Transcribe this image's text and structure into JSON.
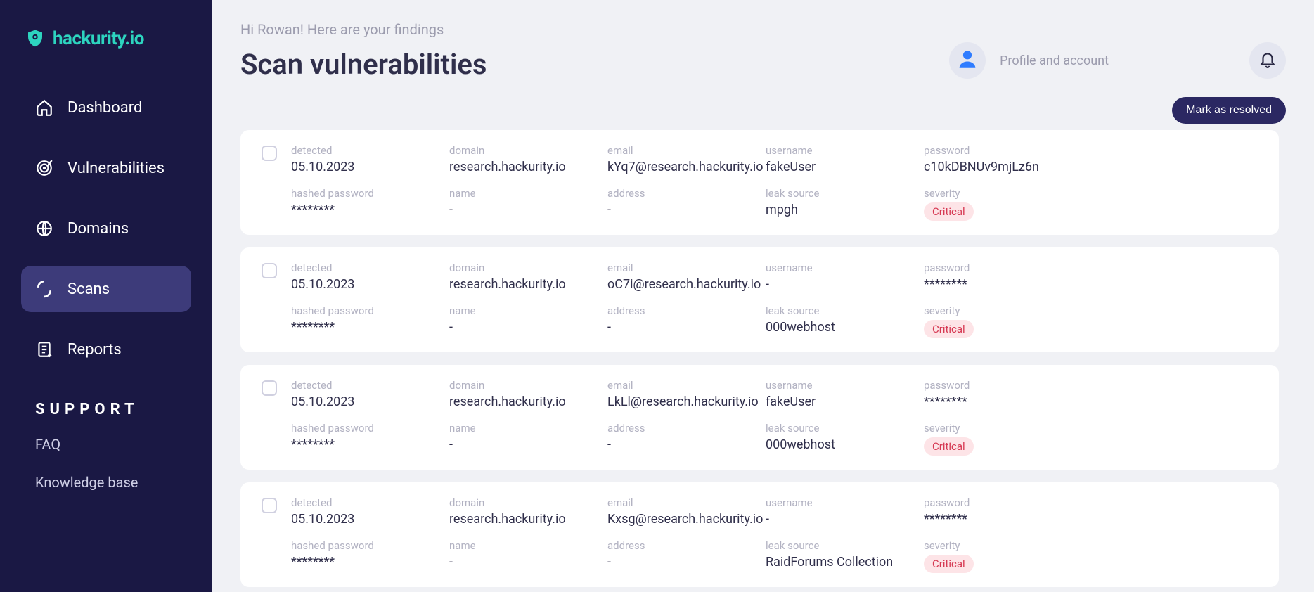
{
  "logo_text": "hackurity.io",
  "nav": {
    "items": [
      {
        "label": "Dashboard",
        "icon": "dashboard-icon",
        "active": false
      },
      {
        "label": "Vulnerabilities",
        "icon": "target-icon",
        "active": false
      },
      {
        "label": "Domains",
        "icon": "globe-icon",
        "active": false
      },
      {
        "label": "Scans",
        "icon": "scan-icon",
        "active": true
      },
      {
        "label": "Reports",
        "icon": "report-icon",
        "active": false
      }
    ],
    "support_heading": "SUPPORT",
    "support_items": [
      "FAQ",
      "Knowledge base"
    ]
  },
  "header": {
    "greeting": "Hi Rowan! Here are your findings",
    "title": "Scan vulnerabilities",
    "profile_label": "Profile and account",
    "resolved_label": "Mark as resolved"
  },
  "field_labels": {
    "detected": "detected",
    "domain": "domain",
    "email": "email",
    "username": "username",
    "password": "password",
    "hashed_password": "hashed password",
    "name": "name",
    "address": "address",
    "leak_source": "leak source",
    "severity": "severity"
  },
  "findings": [
    {
      "detected": "05.10.2023",
      "domain": "research.hackurity.io",
      "email": "kYq7@research.hackurity.io",
      "username": "fakeUser",
      "password": "c10kDBNUv9mjLz6n",
      "hashed_password": "********",
      "name": "-",
      "address": "-",
      "leak_source": "mpgh",
      "severity": "Critical"
    },
    {
      "detected": "05.10.2023",
      "domain": "research.hackurity.io",
      "email": "oC7i@research.hackurity.io",
      "username": "-",
      "password": "********",
      "hashed_password": "********",
      "name": "-",
      "address": "-",
      "leak_source": "000webhost",
      "severity": "Critical"
    },
    {
      "detected": "05.10.2023",
      "domain": "research.hackurity.io",
      "email": "LkLl@research.hackurity.io",
      "username": "fakeUser",
      "password": "********",
      "hashed_password": "********",
      "name": "-",
      "address": "-",
      "leak_source": "000webhost",
      "severity": "Critical"
    },
    {
      "detected": "05.10.2023",
      "domain": "research.hackurity.io",
      "email": "Kxsg@research.hackurity.io",
      "username": "-",
      "password": "********",
      "hashed_password": "********",
      "name": "-",
      "address": "-",
      "leak_source": "RaidForums Collection",
      "severity": "Critical"
    }
  ]
}
